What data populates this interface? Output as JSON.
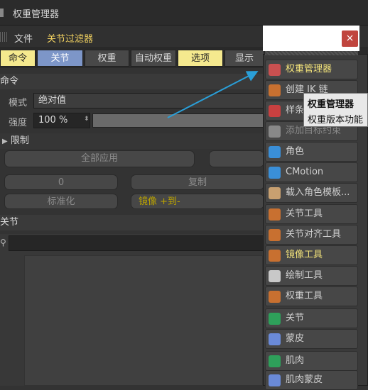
{
  "window": {
    "title": "权重管理器"
  },
  "menubar": {
    "file": "文件",
    "joint_filter": "关节过滤器"
  },
  "tabs": [
    {
      "label": "命令"
    },
    {
      "label": "关节"
    },
    {
      "label": "权重"
    },
    {
      "label": "自动权重"
    },
    {
      "label": "选项"
    },
    {
      "label": "显示"
    }
  ],
  "command_section": {
    "title": "命令",
    "mode_label": "模式",
    "mode_value": "绝对值",
    "strength_label": "强度",
    "strength_value": "100 %",
    "limit_label": "限制",
    "apply_all": "全部应用",
    "zero_value": "0",
    "copy": "复制",
    "normalize": "标准化",
    "mirror": "镜像 +到-"
  },
  "joint_section": {
    "title": "关节"
  },
  "popup": {
    "close": "×",
    "items": [
      {
        "label": "权重管理器",
        "icon": "weight-manager-icon",
        "color": "#c95050",
        "highlight": true
      },
      {
        "label": "创建 IK 链",
        "icon": "ik-chain-icon",
        "color": "#c87030"
      },
      {
        "label": "样条",
        "icon": "spline-icon",
        "color": "#c84040"
      },
      {
        "label": "添加目标约束",
        "icon": "target-constraint-icon",
        "color": "#888888",
        "dim": true
      },
      {
        "label": "角色",
        "icon": "character-icon",
        "color": "#3a8fd8"
      },
      {
        "label": "CMotion",
        "icon": "cmotion-icon",
        "color": "#3a8fd8"
      },
      {
        "label": "载入角色模板...",
        "icon": "character-template-icon",
        "color": "#c8a070"
      },
      {
        "label": "关节工具",
        "icon": "joint-tool-icon",
        "color": "#c87030"
      },
      {
        "label": "关节对齐工具",
        "icon": "joint-align-tool-icon",
        "color": "#c87030"
      },
      {
        "label": "镜像工具",
        "icon": "mirror-tool-icon",
        "color": "#c87030",
        "highlight": true
      },
      {
        "label": "绘制工具",
        "icon": "paint-tool-icon",
        "color": "#c8c8c8"
      },
      {
        "label": "权重工具",
        "icon": "weight-tool-icon",
        "color": "#c87030"
      },
      {
        "label": "关节",
        "icon": "joint-icon",
        "color": "#2ea05a"
      },
      {
        "label": "蒙皮",
        "icon": "skin-icon",
        "color": "#6a8ad8"
      },
      {
        "label": "肌肉",
        "icon": "muscle-icon",
        "color": "#2ea05a"
      },
      {
        "label": "肌肉蒙皮",
        "icon": "muscle-skin-icon",
        "color": "#6a8ad8"
      }
    ]
  },
  "tooltip": {
    "title": "权重管理器",
    "description": "权重版本功能"
  },
  "colors": {
    "accent_yellow": "#f5e98e",
    "accent_blue": "#7d96c8",
    "arrow": "#2a9fd8"
  }
}
